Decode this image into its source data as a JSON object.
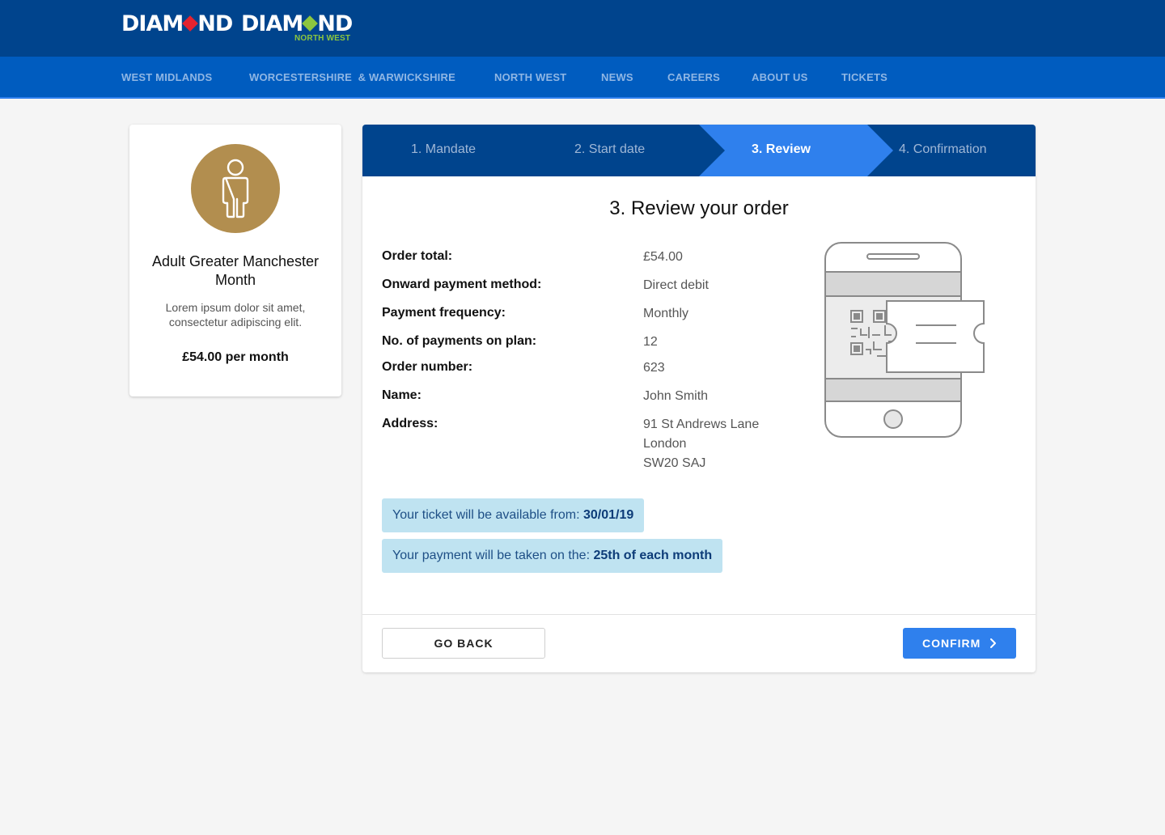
{
  "brand": {
    "logo1": {
      "left": "DIAM",
      "right": "ND"
    },
    "logo2": {
      "left": "DIAM",
      "right": "ND",
      "sub": "NORTH WEST"
    },
    "colors": {
      "navy": "#00448d",
      "nav_blue": "#005cbf",
      "accent": "#2f80ed",
      "gold": "#b28e4f"
    }
  },
  "nav": {
    "items": [
      {
        "label": "WEST MIDLANDS"
      },
      {
        "label": "WORCESTERSHIRE  & WARWICKSHIRE"
      },
      {
        "label": "NORTH WEST"
      },
      {
        "label": "NEWS"
      },
      {
        "label": "CAREERS"
      },
      {
        "label": "ABOUT US"
      },
      {
        "label": "TICKETS"
      }
    ]
  },
  "product": {
    "icon": "person-icon",
    "name": "Adult Greater Manchester Month",
    "description": "Lorem ipsum dolor sit amet, consectetur adipiscing elit.",
    "price": "£54.00 per month"
  },
  "steps": {
    "items": [
      {
        "label": "1. Mandate"
      },
      {
        "label": "2. Start date"
      },
      {
        "label": "3. Review"
      },
      {
        "label": "4. Confirmation"
      }
    ],
    "active_index": 2
  },
  "review": {
    "title": "3. Review your order",
    "rows": [
      {
        "label": "Order total:",
        "value": "£54.00"
      },
      {
        "label": "Onward payment method:",
        "value": "Direct debit"
      },
      {
        "label": "Payment frequency:",
        "value": "Monthly"
      },
      {
        "label": "No. of payments on plan:",
        "value": "12"
      },
      {
        "label": "Order number:",
        "value": "623"
      },
      {
        "label": "Name:",
        "value": "John Smith"
      },
      {
        "label": "Address:",
        "value": [
          "91 St Andrews Lane",
          "London",
          "SW20 SAJ"
        ]
      }
    ],
    "illustration": "mobile-ticket-icon"
  },
  "notices": {
    "available_prefix": "Your ticket will be available from: ",
    "available_date": "30/01/19",
    "payment_prefix": "Your payment will be taken on the: ",
    "payment_day": "25th of each month"
  },
  "actions": {
    "back_label": "GO BACK",
    "confirm_label": "CONFIRM",
    "confirm_icon": "chevron-right-icon"
  }
}
